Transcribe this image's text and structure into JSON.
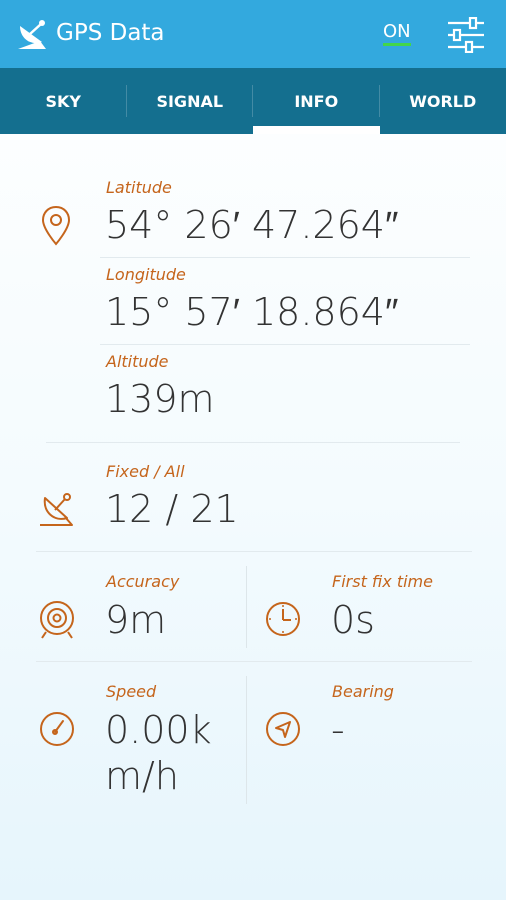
{
  "header": {
    "title": "GPS Data",
    "toggle_label": "ON",
    "app_icon": "satellite-dish-icon",
    "settings_icon": "sliders-icon"
  },
  "tabs": [
    {
      "label": "SKY",
      "active": false
    },
    {
      "label": "SIGNAL",
      "active": false
    },
    {
      "label": "INFO",
      "active": true
    },
    {
      "label": "WORLD",
      "active": false
    }
  ],
  "location": {
    "icon": "map-pin-icon",
    "latitude_label": "Latitude",
    "latitude_value": "54° 26′ 47.264″",
    "longitude_label": "Longitude",
    "longitude_value": "15° 57′ 18.864″",
    "altitude_label": "Altitude",
    "altitude_value": "139m"
  },
  "satellites": {
    "icon": "satellite-dish-icon",
    "label": "Fixed / All",
    "value": "12 / 21"
  },
  "accuracy": {
    "icon": "target-icon",
    "label": "Accuracy",
    "value": "9m"
  },
  "first_fix": {
    "icon": "clock-icon",
    "label": "First fix time",
    "value": "0s"
  },
  "speed": {
    "icon": "speedometer-icon",
    "label": "Speed",
    "value_line1": "0.00k",
    "value_line2": "m/h"
  },
  "bearing": {
    "icon": "compass-arrow-icon",
    "label": "Bearing",
    "value": "-"
  },
  "colors": {
    "appbar": "#33a9de",
    "tabbar": "#146f8f",
    "accent": "#c5651c",
    "toggle_underline": "#43d64a",
    "value_text": "#333333"
  }
}
